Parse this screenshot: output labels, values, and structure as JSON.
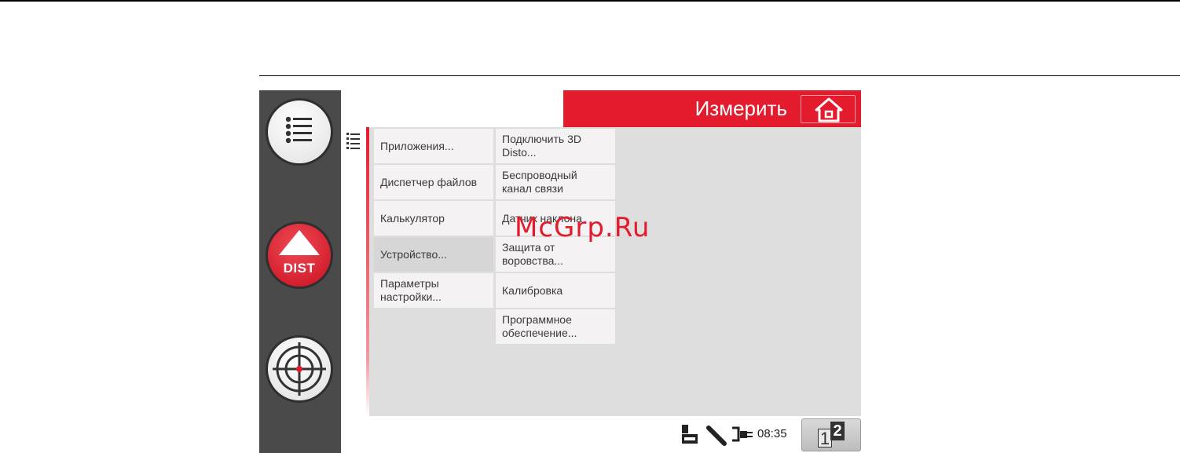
{
  "header": {
    "title": "Измерить"
  },
  "sidebar": {
    "dist_label": "DIST"
  },
  "menu": {
    "column1": [
      {
        "label": "Приложения..."
      },
      {
        "label": "Диспетчер файлов"
      },
      {
        "label": "Калькулятор"
      },
      {
        "label": "Устройство...",
        "selected": true
      },
      {
        "label": "Параметры настройки..."
      }
    ],
    "column2": [
      {
        "label": "Подключить 3D Disto..."
      },
      {
        "label": "Беспроводный канал связи"
      },
      {
        "label": "Датчик наклона"
      },
      {
        "label": "Защита от воровства..."
      },
      {
        "label": "Калибровка"
      },
      {
        "label": "Программное обеспечение..."
      }
    ]
  },
  "status": {
    "time": "08:35",
    "page_1": "1",
    "page_2": "2"
  },
  "watermark": "McGrp.Ru",
  "colors": {
    "accent": "#e31b2d",
    "sidebar": "#4a4a4a",
    "panel": "#dedede"
  },
  "icons": [
    "list-icon",
    "home-icon",
    "memory-card-icon",
    "bluetooth-probe-icon",
    "power-plug-icon",
    "target-icon"
  ]
}
